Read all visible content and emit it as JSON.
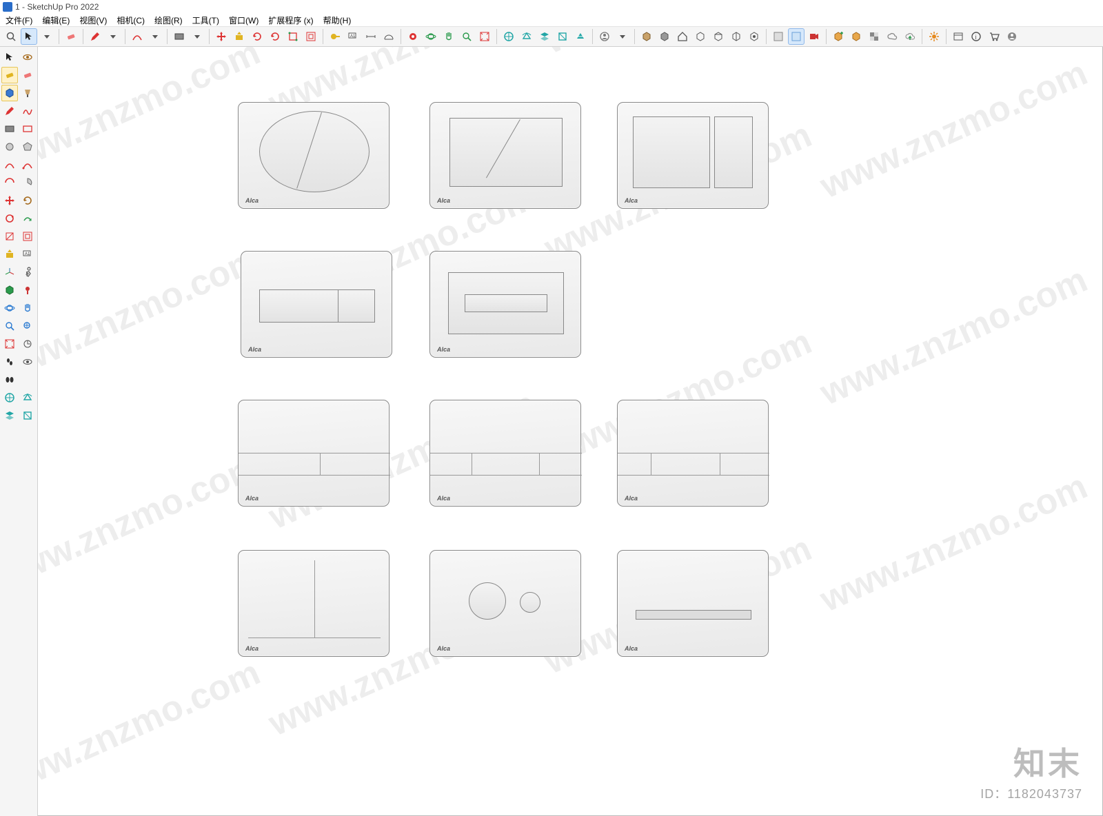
{
  "title": "1 - SketchUp Pro 2022",
  "menu": [
    "文件(F)",
    "编辑(E)",
    "视图(V)",
    "相机(C)",
    "绘图(R)",
    "工具(T)",
    "窗口(W)",
    "扩展程序 (x)",
    "帮助(H)"
  ],
  "toolbar_icons": [
    "search",
    "select",
    "select-dropdown",
    "|",
    "eraser",
    "|",
    "pencil",
    "pencil-dropdown",
    "|",
    "arc",
    "arc-dropdown",
    "|",
    "rect",
    "rect-dropdown",
    "|",
    "move",
    "pushpull",
    "rotate",
    "rotate2",
    "scale",
    "offset",
    "|",
    "tape",
    "text-label",
    "dimension",
    "protractor",
    "|",
    "extension-red",
    "orbit",
    "pan",
    "zoom",
    "zoom-extents",
    "|",
    "section-blue",
    "section-cyan",
    "layers",
    "section-display",
    "section-cut",
    "|",
    "user-circle",
    "user-dropdown",
    "|",
    "box1",
    "box2",
    "house",
    "box3",
    "box4",
    "box5",
    "box6",
    "|",
    "face-style1",
    "face-style2",
    "video",
    "|",
    "geo-add",
    "geo-box",
    "geo-check",
    "geo-cloud",
    "geo-export",
    "|",
    "settings-orange",
    "|",
    "window",
    "info",
    "cart",
    "profile"
  ],
  "sidebar_rows": [
    [
      "select-arrow",
      "orbit-eye"
    ],
    [
      "eraser-y",
      "eraser2"
    ],
    [
      "component-blue",
      "paint"
    ],
    [
      "pencil-red",
      "freehand"
    ],
    [
      "rect-tool",
      "rect-wire"
    ],
    [
      "circle",
      "polygon"
    ],
    [
      "arc-red",
      "arc2"
    ],
    [
      "arc3",
      "pie"
    ],
    [
      "move-red",
      "rotate-tool"
    ],
    [
      "follow",
      "followme-g"
    ],
    [
      "scale-red",
      "offset-red"
    ],
    [
      "pushpull-y",
      "text-a1"
    ],
    [
      "axes",
      "walk"
    ],
    [
      "section-g",
      "position"
    ],
    [
      "orbit-blue",
      "pan-blue"
    ],
    [
      "zoom-blue",
      "zoom-prev"
    ],
    [
      "zoom-ext",
      "look"
    ],
    [
      "walk-ft",
      "look-eye"
    ],
    [
      "shoes",
      ""
    ],
    [
      "view-iso",
      "section-blue2"
    ],
    [
      "layers-blue",
      "section-cyan2"
    ]
  ],
  "plate_brand": "Alca",
  "watermark_text": "www.znzmo.com",
  "corner_logo": "知末",
  "corner_id": "ID：1182043737"
}
